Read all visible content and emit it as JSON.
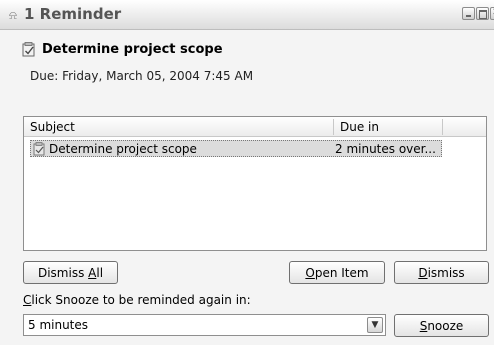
{
  "window": {
    "title": "1 Reminder"
  },
  "reminder": {
    "subject": "Determine project scope",
    "due_line": "Due: Friday, March 05, 2004 7:45 AM"
  },
  "list": {
    "columns": [
      "Subject",
      "Due in"
    ],
    "rows": [
      {
        "subject": "Determine project scope",
        "due_in": "2 minutes over..."
      }
    ]
  },
  "buttons": {
    "dismiss_all_pre": "Dismiss ",
    "dismiss_all_key": "A",
    "dismiss_all_post": "ll",
    "open_item_key": "O",
    "open_item_post": "pen Item",
    "dismiss_key": "D",
    "dismiss_post": "ismiss",
    "snooze_key": "S",
    "snooze_post": "nooze"
  },
  "snooze": {
    "label_key": "C",
    "label_post": "lick Snooze to be reminded again in:",
    "selected": "5 minutes"
  }
}
